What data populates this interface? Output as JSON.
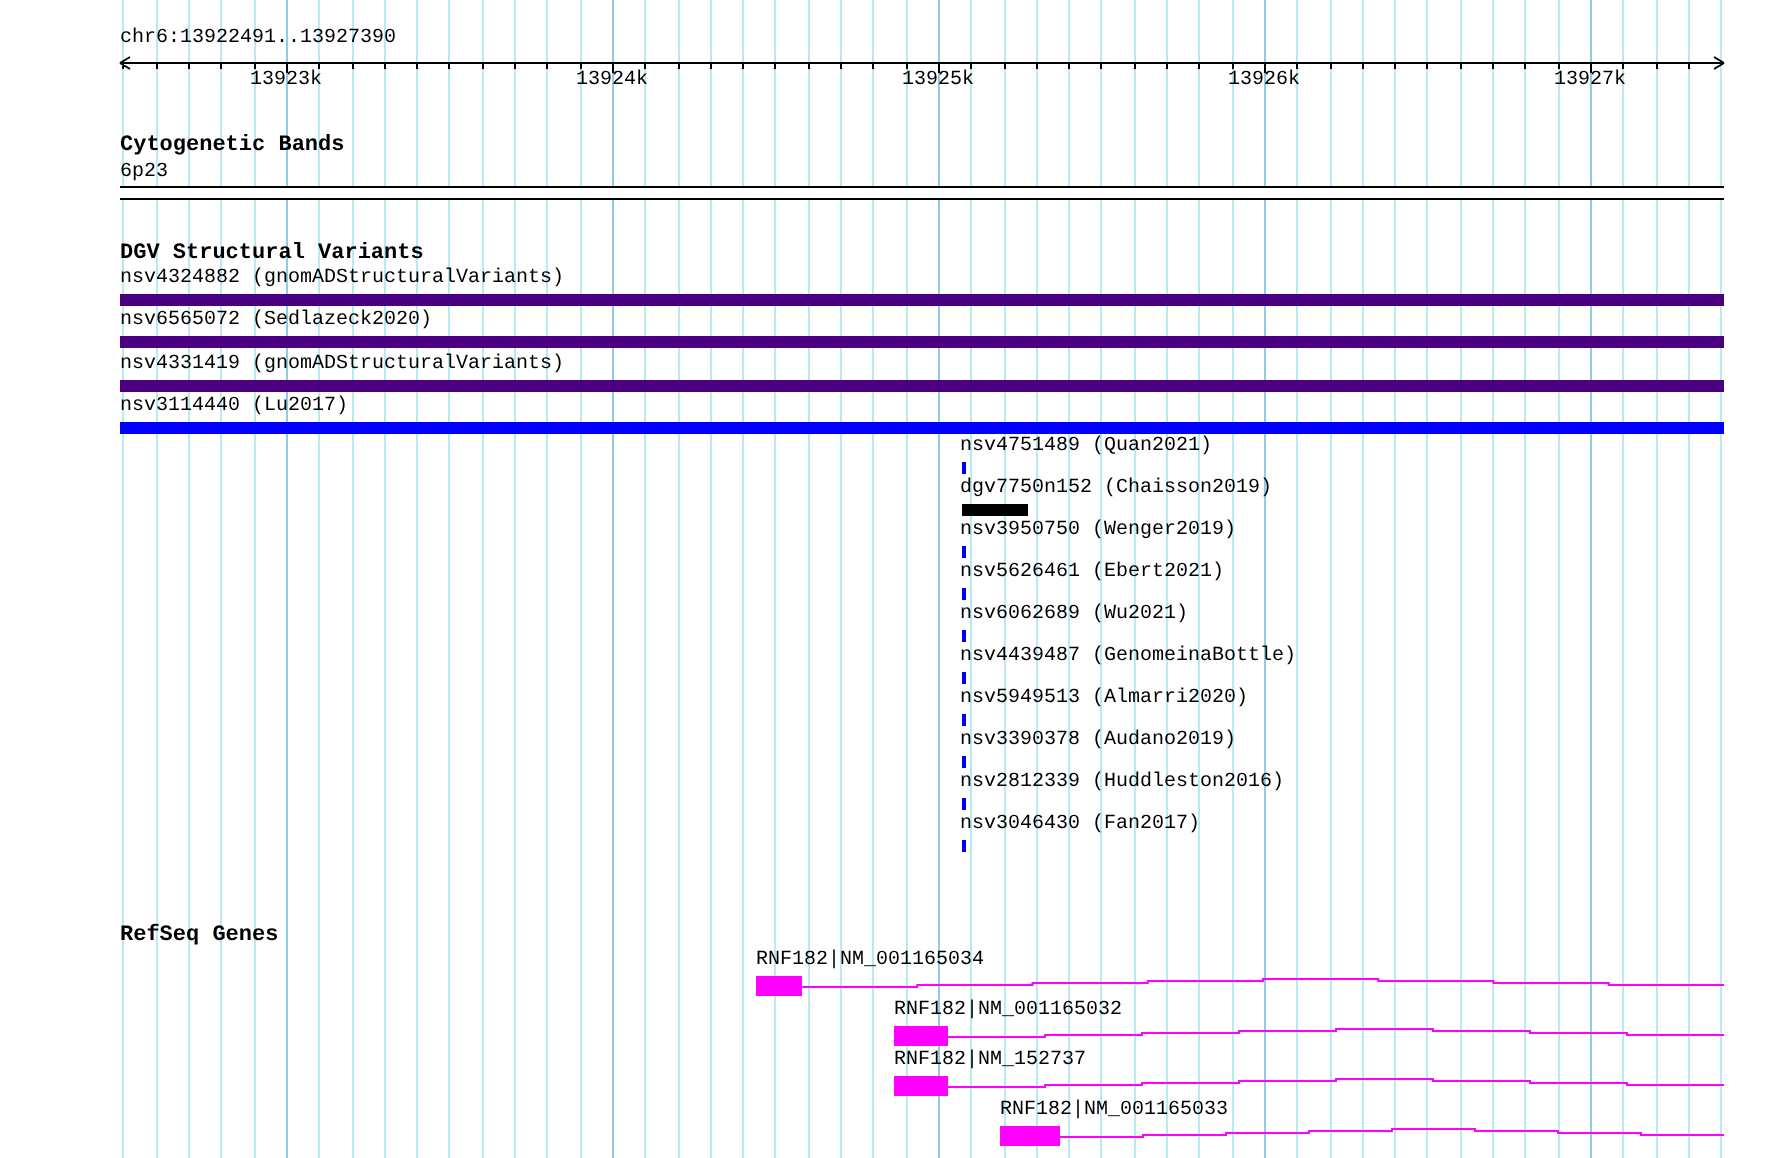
{
  "ruler": {
    "location": "chr6:13922491..13927390",
    "ticks": [
      "13923k",
      "13924k",
      "13925k",
      "13926k",
      "13927k"
    ]
  },
  "tracks": [
    {
      "kind": "cytoband",
      "title": "Cytogenetic Bands",
      "items": [
        {
          "label": "6p23"
        }
      ]
    },
    {
      "kind": "variants",
      "title": "DGV Structural Variants",
      "items": [
        {
          "label": "nsv4324882 (gnomADStructuralVariants)",
          "color": "#4b0082"
        },
        {
          "label": "nsv6565072 (Sedlazeck2020)",
          "color": "#4b0082"
        },
        {
          "label": "nsv4331419 (gnomADStructuralVariants)",
          "color": "#4b0082"
        },
        {
          "label": "nsv3114440 (Lu2017)",
          "color": "#0000ff"
        },
        {
          "label": "nsv4751489 (Quan2021)",
          "color": "#0000ff"
        },
        {
          "label": "dgv7750n152 (Chaisson2019)",
          "color": "#000000"
        },
        {
          "label": "nsv3950750 (Wenger2019)",
          "color": "#0000ff"
        },
        {
          "label": "nsv5626461 (Ebert2021)",
          "color": "#0000ff"
        },
        {
          "label": "nsv6062689 (Wu2021)",
          "color": "#0000ff"
        },
        {
          "label": "nsv4439487 (GenomeinaBottle)",
          "color": "#0000ff"
        },
        {
          "label": "nsv5949513 (Almarri2020)",
          "color": "#0000ff"
        },
        {
          "label": "nsv3390378 (Audano2019)",
          "color": "#0000ff"
        },
        {
          "label": "nsv2812339 (Huddleston2016)",
          "color": "#0000ff"
        },
        {
          "label": "nsv3046430 (Fan2017)",
          "color": "#0000ff"
        }
      ]
    },
    {
      "kind": "genes",
      "title": "RefSeq Genes",
      "items": [
        {
          "label": "RNF182|NM_001165034",
          "color": "#ff00ff"
        },
        {
          "label": "RNF182|NM_001165032",
          "color": "#ff00ff"
        },
        {
          "label": "RNF182|NM_152737",
          "color": "#ff00ff"
        },
        {
          "label": "RNF182|NM_001165033",
          "color": "#ff00ff"
        }
      ]
    }
  ]
}
